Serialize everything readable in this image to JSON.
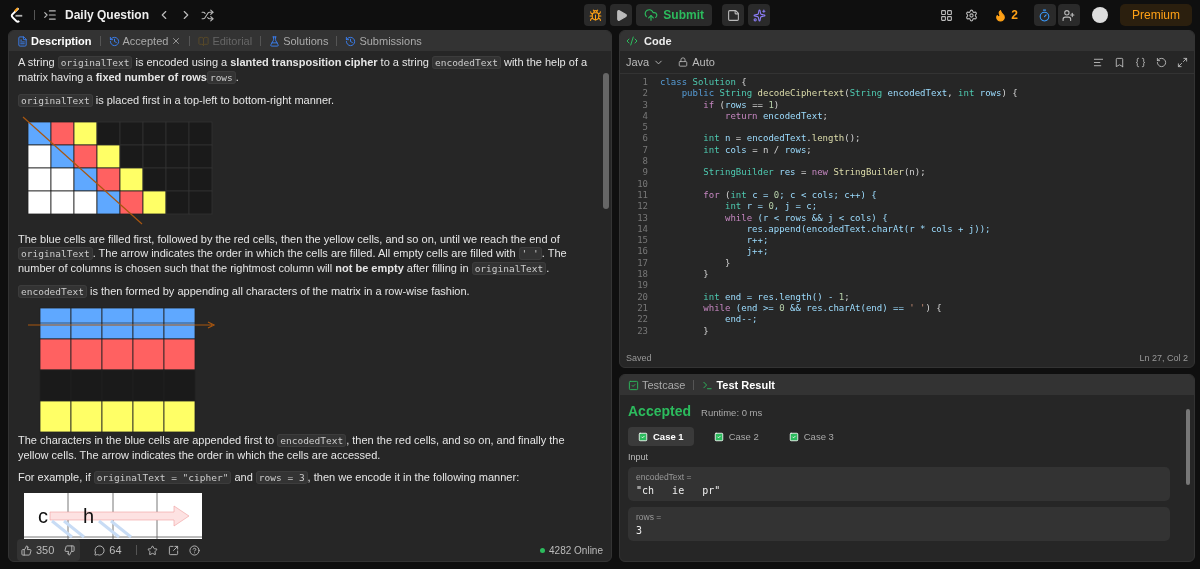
{
  "topbar": {
    "title": "Daily Question",
    "submit": "Submit",
    "streak": "2",
    "premium": "Premium"
  },
  "description": {
    "tabs": [
      {
        "label": "Description",
        "selected": true,
        "disabled": false,
        "closable": false
      },
      {
        "label": "Accepted",
        "selected": false,
        "disabled": false,
        "closable": true
      },
      {
        "label": "Editorial",
        "selected": false,
        "disabled": true,
        "closable": false
      },
      {
        "label": "Solutions",
        "selected": false,
        "disabled": false,
        "closable": false
      },
      {
        "label": "Submissions",
        "selected": false,
        "disabled": false,
        "closable": false
      }
    ],
    "blocks": [
      {
        "kind": "paragraph",
        "text": "A string ",
        "segments": [
          {
            "kind": "code",
            "text": "originalText"
          },
          {
            "kind": "text",
            "text": " is encoded using a "
          },
          {
            "kind": "bold",
            "text": "slanted transposition cipher"
          },
          {
            "kind": "text",
            "text": " to a string "
          },
          {
            "kind": "code",
            "text": "encodedText"
          },
          {
            "kind": "text",
            "text": " with the help of a matrix having a "
          },
          {
            "kind": "bold",
            "text": "fixed number of rows"
          },
          {
            "kind": "code",
            "text": "rows"
          },
          {
            "kind": "text",
            "text": "."
          }
        ]
      },
      {
        "kind": "paragraph",
        "segments": [
          {
            "kind": "code",
            "text": "originalText"
          },
          {
            "kind": "text",
            "text": " is placed first in a top-left to bottom-right manner."
          }
        ]
      },
      {
        "kind": "figure"
      },
      {
        "kind": "paragraph",
        "segments": [
          {
            "kind": "text",
            "text": "The blue cells are filled first, followed by the red cells, then the yellow cells, and so on, until we reach the end of "
          },
          {
            "kind": "code",
            "text": "originalText"
          },
          {
            "kind": "text",
            "text": ". The arrow indicates the order in which the cells are filled. All empty cells are filled with "
          },
          {
            "kind": "code",
            "text": "' '"
          },
          {
            "kind": "text",
            "text": ". The number of columns is chosen such that the rightmost column will "
          },
          {
            "kind": "bold",
            "text": "not be empty"
          },
          {
            "kind": "text",
            "text": " after filling in "
          },
          {
            "kind": "code",
            "text": "originalText"
          },
          {
            "kind": "text",
            "text": "."
          }
        ]
      },
      {
        "kind": "paragraph",
        "segments": [
          {
            "kind": "code",
            "text": "encodedText"
          },
          {
            "kind": "text",
            "text": " is then formed by appending all characters of the matrix in a row-wise fashion."
          }
        ]
      },
      {
        "kind": "figure"
      },
      {
        "kind": "paragraph",
        "segments": [
          {
            "kind": "text",
            "text": "The characters in the blue cells are appended first to "
          },
          {
            "kind": "code",
            "text": "encodedText"
          },
          {
            "kind": "text",
            "text": ", then the red cells, and so on, and finally the yellow cells. The arrow indicates the order in which the cells are accessed."
          }
        ]
      },
      {
        "kind": "paragraph",
        "segments": [
          {
            "kind": "text",
            "text": "For example, if "
          },
          {
            "kind": "code",
            "text": "originalText = \"cipher\""
          },
          {
            "kind": "text",
            "text": " and "
          },
          {
            "kind": "code",
            "text": "rows = 3"
          },
          {
            "kind": "text",
            "text": ", then we encode it in the following manner:"
          }
        ]
      },
      {
        "kind": "figure",
        "letters": [
          "c",
          "h"
        ]
      }
    ],
    "likes": "350",
    "comments": "64",
    "online": "4282 Online"
  },
  "code": {
    "title": "Code",
    "language": "Java",
    "mode": "Auto",
    "status": "Saved",
    "cursor": "Ln 27, Col 2",
    "lines": [
      {
        "n": "1",
        "seg": [
          {
            "kind": "kw",
            "text": "class "
          },
          {
            "kind": "ty",
            "text": "Solution"
          },
          {
            "kind": "p",
            "text": " {"
          }
        ]
      },
      {
        "n": "2",
        "seg": [
          {
            "kind": "kw",
            "text": "    public "
          },
          {
            "kind": "ty",
            "text": "String "
          },
          {
            "kind": "fn",
            "text": "decodeCiphertext"
          },
          {
            "kind": "p",
            "text": "("
          },
          {
            "kind": "ty",
            "text": "String "
          },
          {
            "kind": "id",
            "text": "encodedText"
          },
          {
            "kind": "p",
            "text": ", "
          },
          {
            "kind": "ty",
            "text": "int "
          },
          {
            "kind": "id",
            "text": "rows"
          },
          {
            "kind": "p",
            "text": ") {"
          }
        ]
      },
      {
        "n": "3",
        "seg": [
          {
            "kind": "ctl",
            "text": "        if "
          },
          {
            "kind": "p",
            "text": "("
          },
          {
            "kind": "id",
            "text": "rows"
          },
          {
            "kind": "p",
            "text": " == "
          },
          {
            "kind": "num",
            "text": "1"
          },
          {
            "kind": "p",
            "text": ")"
          }
        ]
      },
      {
        "n": "4",
        "seg": [
          {
            "kind": "ctl",
            "text": "            return "
          },
          {
            "kind": "id",
            "text": "encodedText"
          },
          {
            "kind": "p",
            "text": ";"
          }
        ]
      },
      {
        "n": "5"
      },
      {
        "n": "6",
        "seg": [
          {
            "kind": "ty",
            "text": "        int "
          },
          {
            "kind": "id",
            "text": "n"
          },
          {
            "kind": "p",
            "text": " = "
          },
          {
            "kind": "id",
            "text": "encodedText"
          },
          {
            "kind": "p",
            "text": "."
          },
          {
            "kind": "fn",
            "text": "length"
          },
          {
            "kind": "p",
            "text": "();"
          }
        ]
      },
      {
        "n": "7",
        "seg": [
          {
            "kind": "ty",
            "text": "        int "
          },
          {
            "kind": "id",
            "text": "cols"
          },
          {
            "kind": "p",
            "text": " = n / "
          },
          {
            "kind": "id",
            "text": "rows"
          },
          {
            "kind": "p",
            "text": ";"
          }
        ]
      },
      {
        "n": "8"
      },
      {
        "n": "9",
        "seg": [
          {
            "kind": "ty",
            "text": "        StringBuilder "
          },
          {
            "kind": "id",
            "text": "res"
          },
          {
            "kind": "p",
            "text": " = "
          },
          {
            "kind": "ctl",
            "text": "new "
          },
          {
            "kind": "fn",
            "text": "StringBuilder"
          },
          {
            "kind": "p",
            "text": "(n);"
          }
        ]
      },
      {
        "n": "10"
      },
      {
        "n": "11",
        "seg": [
          {
            "kind": "ctl",
            "text": "        for "
          },
          {
            "kind": "p",
            "text": "("
          },
          {
            "kind": "ty",
            "text": "int "
          },
          {
            "kind": "id",
            "text": "c = "
          },
          {
            "kind": "num",
            "text": "0"
          },
          {
            "kind": "id",
            "text": "; c < cols; c++) {"
          }
        ]
      },
      {
        "n": "12",
        "seg": [
          {
            "kind": "ty",
            "text": "            int "
          },
          {
            "kind": "id",
            "text": "r = "
          },
          {
            "kind": "num",
            "text": "0"
          },
          {
            "kind": "id",
            "text": ", j = c;"
          }
        ]
      },
      {
        "n": "13",
        "seg": [
          {
            "kind": "ctl",
            "text": "            while "
          },
          {
            "kind": "id",
            "text": "(r < rows && j < cols) {"
          }
        ]
      },
      {
        "n": "14",
        "seg": [
          {
            "kind": "id",
            "text": "                res.append(encodedText.charAt(r * cols + j));"
          }
        ]
      },
      {
        "n": "15",
        "seg": [
          {
            "kind": "id",
            "text": "                r++;"
          }
        ]
      },
      {
        "n": "16",
        "seg": [
          {
            "kind": "id",
            "text": "                j++;"
          }
        ]
      },
      {
        "n": "17",
        "seg": [
          {
            "kind": "p",
            "text": "            }"
          }
        ]
      },
      {
        "n": "18",
        "seg": [
          {
            "kind": "p",
            "text": "        }"
          }
        ]
      },
      {
        "n": "19"
      },
      {
        "n": "20",
        "seg": [
          {
            "kind": "ty",
            "text": "        int "
          },
          {
            "kind": "id",
            "text": "end = res.length() - "
          },
          {
            "kind": "num",
            "text": "1"
          },
          {
            "kind": "p",
            "text": ";"
          }
        ]
      },
      {
        "n": "21",
        "seg": [
          {
            "kind": "ctl",
            "text": "        while "
          },
          {
            "kind": "id",
            "text": "(end >= "
          },
          {
            "kind": "num",
            "text": "0"
          },
          {
            "kind": "id",
            "text": " && res.charAt(end) == "
          },
          {
            "kind": "str",
            "text": "' '"
          },
          {
            "kind": "p",
            "text": ") {"
          }
        ]
      },
      {
        "n": "22",
        "seg": [
          {
            "kind": "id",
            "text": "            end--;"
          }
        ]
      },
      {
        "n": "23",
        "seg": [
          {
            "kind": "p",
            "text": "        }"
          }
        ]
      }
    ]
  },
  "test": {
    "tabs": [
      {
        "label": "Testcase",
        "selected": false
      },
      {
        "label": "Test Result",
        "selected": true
      }
    ],
    "verdict": "Accepted",
    "runtime": "Runtime: 0 ms",
    "cases": [
      {
        "label": "Case 1",
        "selected": true
      },
      {
        "label": "Case 2",
        "selected": false
      },
      {
        "label": "Case 3",
        "selected": false
      }
    ],
    "input_label": "Input",
    "inputs": [
      {
        "name": "encodedText =",
        "value": "\"ch   ie   pr\""
      },
      {
        "name": "rows =",
        "value": "3"
      }
    ]
  }
}
